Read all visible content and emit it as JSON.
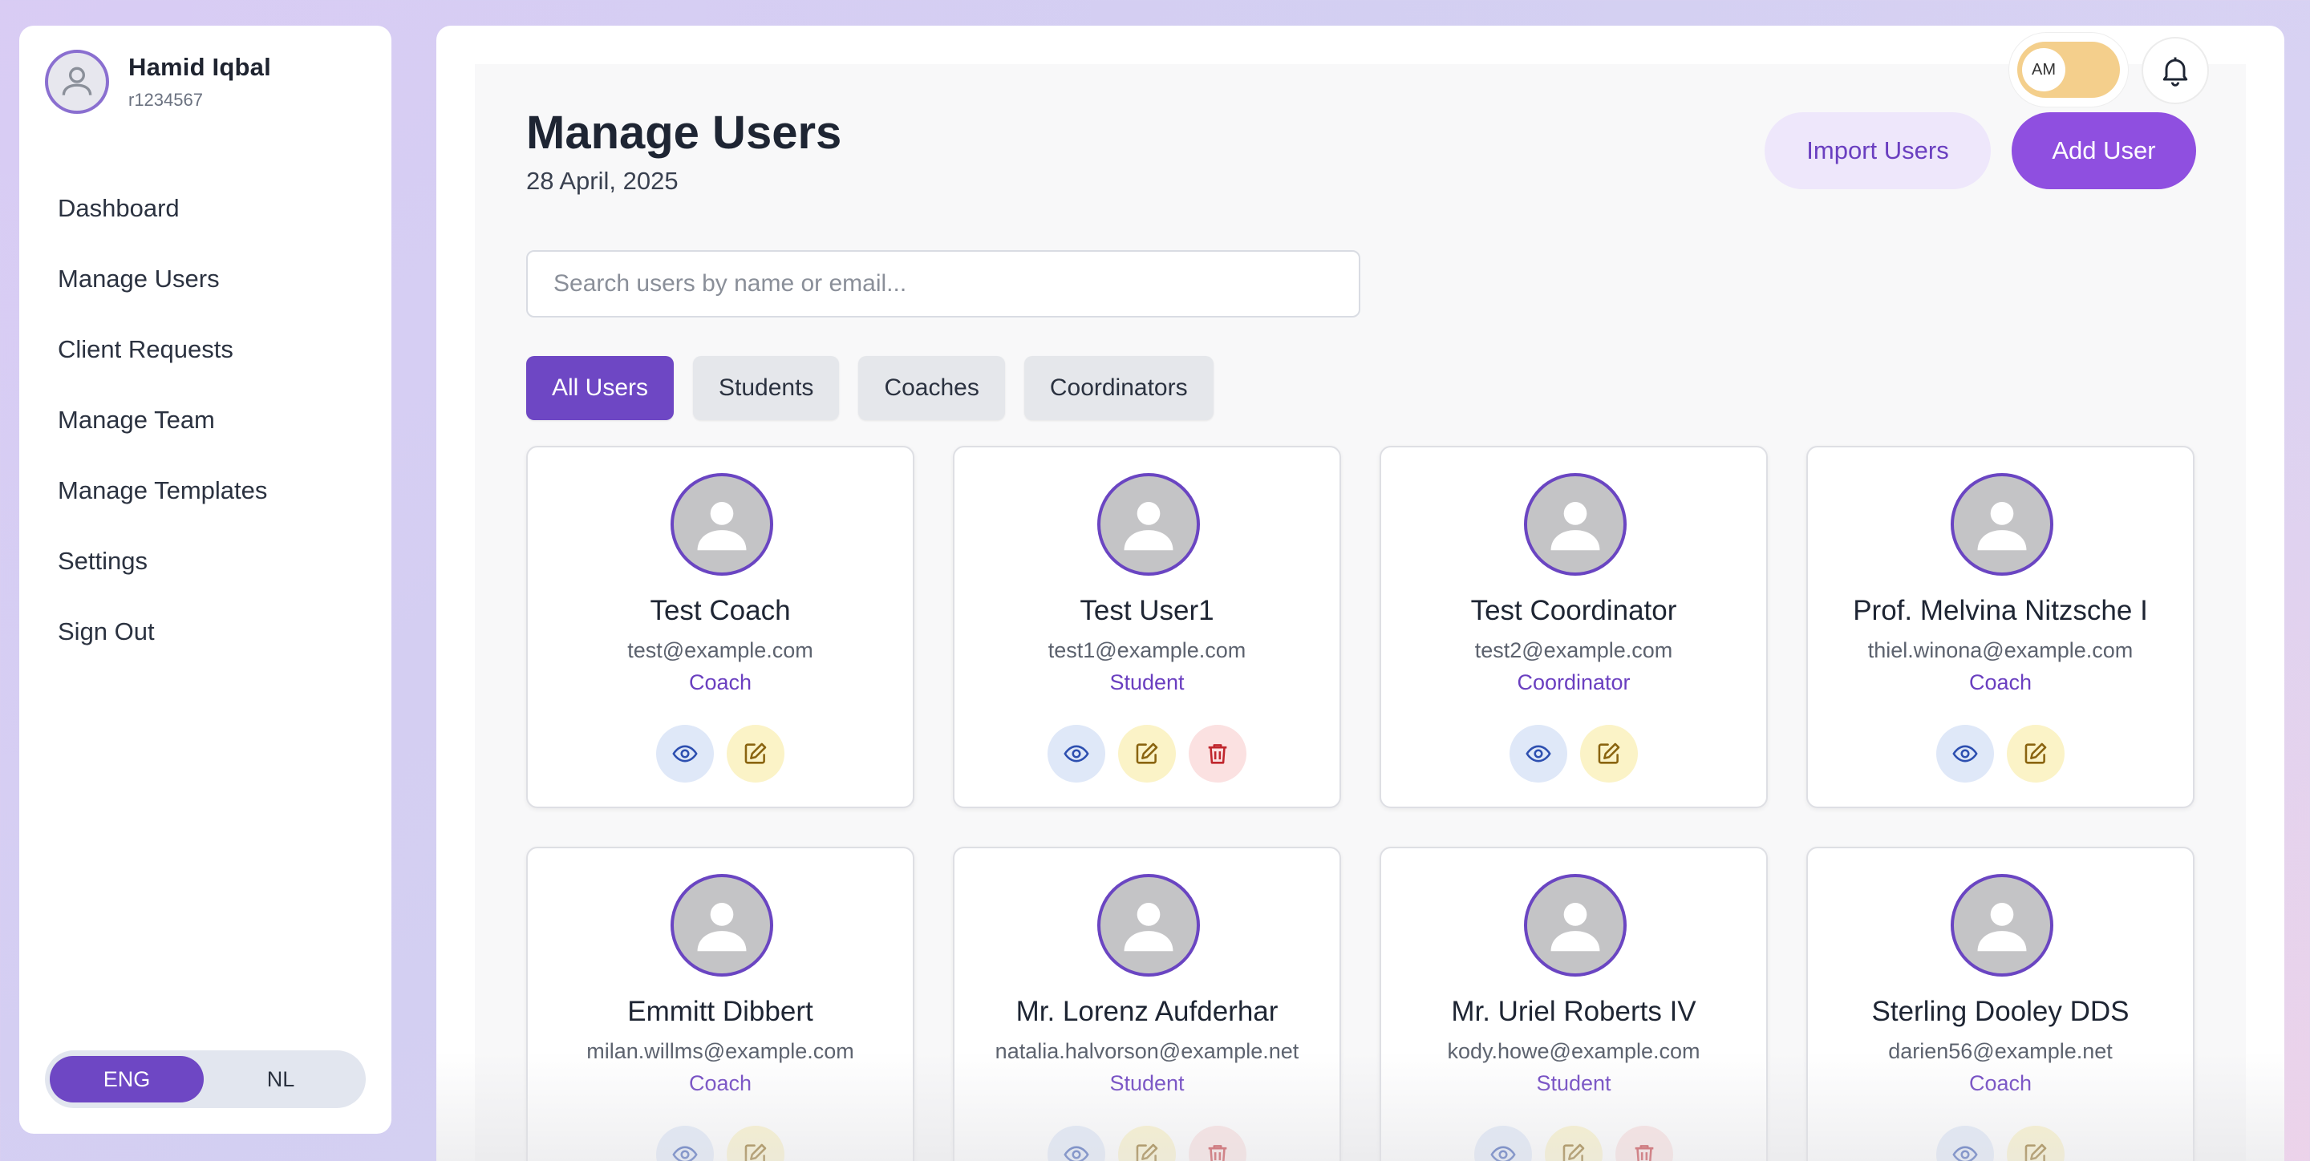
{
  "sidebar": {
    "profile": {
      "name": "Hamid Iqbal",
      "id": "r1234567"
    },
    "items": [
      {
        "label": "Dashboard",
        "name": "sidebar-item-dashboard"
      },
      {
        "label": "Manage Users",
        "name": "sidebar-item-manage-users"
      },
      {
        "label": "Client Requests",
        "name": "sidebar-item-client-requests"
      },
      {
        "label": "Manage Team",
        "name": "sidebar-item-manage-team"
      },
      {
        "label": "Manage Templates",
        "name": "sidebar-item-manage-templates"
      },
      {
        "label": "Settings",
        "name": "sidebar-item-settings"
      },
      {
        "label": "Sign Out",
        "name": "sidebar-item-sign-out"
      }
    ],
    "language": {
      "options": [
        "ENG",
        "NL"
      ],
      "selected": "ENG"
    }
  },
  "topbar": {
    "toggle_initials": "AM",
    "bell_icon": "bell-icon"
  },
  "header": {
    "title": "Manage Users",
    "date": "28 April, 2025",
    "import_label": "Import Users",
    "add_label": "Add User"
  },
  "search": {
    "placeholder": "Search users by name or email...",
    "value": ""
  },
  "filters": {
    "items": [
      "All Users",
      "Students",
      "Coaches",
      "Coordinators"
    ],
    "active": "All Users"
  },
  "users": [
    {
      "name": "Test Coach",
      "email": "test@example.com",
      "role": "Coach",
      "deletable": false
    },
    {
      "name": "Test User1",
      "email": "test1@example.com",
      "role": "Student",
      "deletable": true
    },
    {
      "name": "Test Coordinator",
      "email": "test2@example.com",
      "role": "Coordinator",
      "deletable": false
    },
    {
      "name": "Prof. Melvina Nitzsche I",
      "email": "thiel.winona@example.com",
      "role": "Coach",
      "deletable": false
    },
    {
      "name": "Emmitt Dibbert",
      "email": "milan.willms@example.com",
      "role": "Coach",
      "deletable": false
    },
    {
      "name": "Mr. Lorenz Aufderhar",
      "email": "natalia.halvorson@example.net",
      "role": "Student",
      "deletable": true
    },
    {
      "name": "Mr. Uriel Roberts IV",
      "email": "kody.howe@example.com",
      "role": "Student",
      "deletable": true
    },
    {
      "name": "Sterling Dooley DDS",
      "email": "darien56@example.net",
      "role": "Coach",
      "deletable": false
    }
  ],
  "colors": {
    "accent": "#6e47c4",
    "add_button": "#8f4fe0",
    "toggle": "#f4cf8c",
    "view": "#dfe8f8",
    "edit": "#fbf3c7",
    "delete": "#fbe1e1"
  },
  "icons": {
    "view": "eye-icon",
    "edit": "edit-icon",
    "delete": "trash-icon",
    "avatar": "user-avatar-icon"
  }
}
